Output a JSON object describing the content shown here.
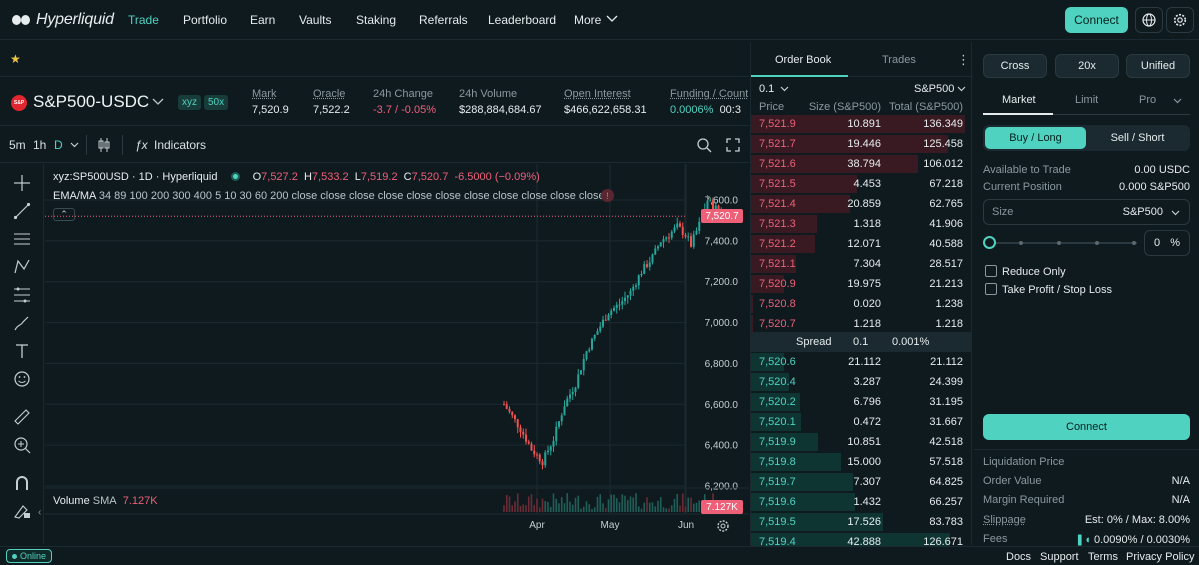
{
  "nav": {
    "logo": "Hyperliquid",
    "items": [
      "Trade",
      "Portfolio",
      "Earn",
      "Vaults",
      "Staking",
      "Referrals",
      "Leaderboard",
      "More"
    ],
    "connect_label": "Connect"
  },
  "market": {
    "name": "S&P500-USDC",
    "logo_text": "S&P",
    "tag_dex": "xyz",
    "tag_leverage": "50x",
    "stats": [
      {
        "label": "Mark",
        "value": "7,520.9"
      },
      {
        "label": "Oracle",
        "value": "7,522.2"
      },
      {
        "label": "24h Change",
        "value": "-3.7 / -0.05%"
      },
      {
        "label": "24h Volume",
        "value": "$288,884,684.67"
      },
      {
        "label": "Open Interest",
        "value": "$466,622,658.31"
      },
      {
        "label": "Funding / Count",
        "value": "0.0006%",
        "value2": "00:3"
      }
    ]
  },
  "chart_toolbar": {
    "intervals": [
      "5m",
      "1h",
      "D"
    ],
    "indicators_label": "Indicators"
  },
  "chart": {
    "symbol_line": "xyz:SP500USD · 1D · Hyperliquid",
    "ohlc": {
      "o": "7,527.2",
      "h": "7,533.2",
      "l": "7,519.2",
      "c": "7,520.7",
      "chg": "-6.5000 (−0.09%)"
    },
    "ema_label": "EMA/MA",
    "ema_params": "34 89 100 200 300 400 5 10 30 60 200 close close close close close close close close close close close",
    "volume_label": "Volume",
    "volume_sma": "SMA",
    "volume_value": "7.127K",
    "last_price_tag": "7,520.7",
    "volume_tag": "7.127K"
  },
  "chart_data": {
    "type": "candlestick",
    "yticks": [
      "7,600.0",
      "7,400.0",
      "7,200.0",
      "7,000.0",
      "6,800.0",
      "6,600.0",
      "6,400.0",
      "6,200.0"
    ],
    "ylim": [
      6200,
      7600
    ],
    "xticks": [
      "Apr",
      "May",
      "Jun"
    ],
    "last_price": 7520.7
  },
  "orderbook": {
    "tabs": [
      "Order Book",
      "Trades"
    ],
    "tick": "0.1",
    "symbol": "S&P500",
    "headers": [
      "Price",
      "Size (S&P500)",
      "Total (S&P500)"
    ],
    "asks": [
      [
        "7,521.9",
        "10.891",
        "136.349"
      ],
      [
        "7,521.7",
        "19.446",
        "125.458"
      ],
      [
        "7,521.6",
        "38.794",
        "106.012"
      ],
      [
        "7,521.5",
        "4.453",
        "67.218"
      ],
      [
        "7,521.4",
        "20.859",
        "62.765"
      ],
      [
        "7,521.3",
        "1.318",
        "41.906"
      ],
      [
        "7,521.2",
        "12.071",
        "40.588"
      ],
      [
        "7,521.1",
        "7.304",
        "28.517"
      ],
      [
        "7,520.9",
        "19.975",
        "21.213"
      ],
      [
        "7,520.8",
        "0.020",
        "1.238"
      ],
      [
        "7,520.7",
        "1.218",
        "1.218"
      ]
    ],
    "spread": {
      "label": "Spread",
      "value": "0.1",
      "pct": "0.001%"
    },
    "bids": [
      [
        "7,520.6",
        "21.112",
        "21.112"
      ],
      [
        "7,520.4",
        "3.287",
        "24.399"
      ],
      [
        "7,520.2",
        "6.796",
        "31.195"
      ],
      [
        "7,520.1",
        "0.472",
        "31.667"
      ],
      [
        "7,519.9",
        "10.851",
        "42.518"
      ],
      [
        "7,519.8",
        "15.000",
        "57.518"
      ],
      [
        "7,519.7",
        "7.307",
        "64.825"
      ],
      [
        "7,519.6",
        "1.432",
        "66.257"
      ],
      [
        "7,519.5",
        "17.526",
        "83.783"
      ],
      [
        "7,519.4",
        "42.888",
        "126.671"
      ]
    ]
  },
  "trade": {
    "margin_mode": "Cross",
    "leverage": "20x",
    "account": "Unified",
    "order_tabs": [
      "Market",
      "Limit",
      "Pro"
    ],
    "buy_label": "Buy / Long",
    "sell_label": "Sell / Short",
    "available_label": "Available to Trade",
    "available_value": "0.00 USDC",
    "position_label": "Current Position",
    "position_value": "0.000 S&P500",
    "size_placeholder": "Size",
    "size_unit": "S&P500",
    "percent_value": "0",
    "percent_sign": "%",
    "reduce_only": "Reduce Only",
    "tpsl": "Take Profit / Stop Loss",
    "connect_label": "Connect",
    "info": [
      {
        "k": "Liquidation Price",
        "v": ""
      },
      {
        "k": "Order Value",
        "v": "N/A"
      },
      {
        "k": "Margin Required",
        "v": "N/A"
      },
      {
        "k": "Slippage",
        "v": "Est: 0% / Max: 8.00%"
      },
      {
        "k": "Fees",
        "v": "0.0090% / 0.0030%"
      }
    ]
  },
  "footer": {
    "status": "Online",
    "links": [
      "Docs",
      "Support",
      "Terms",
      "Privacy Policy"
    ]
  },
  "colors": {
    "accent": "#50d2c1",
    "negative": "#ed6078",
    "background": "#0f1a1f"
  }
}
